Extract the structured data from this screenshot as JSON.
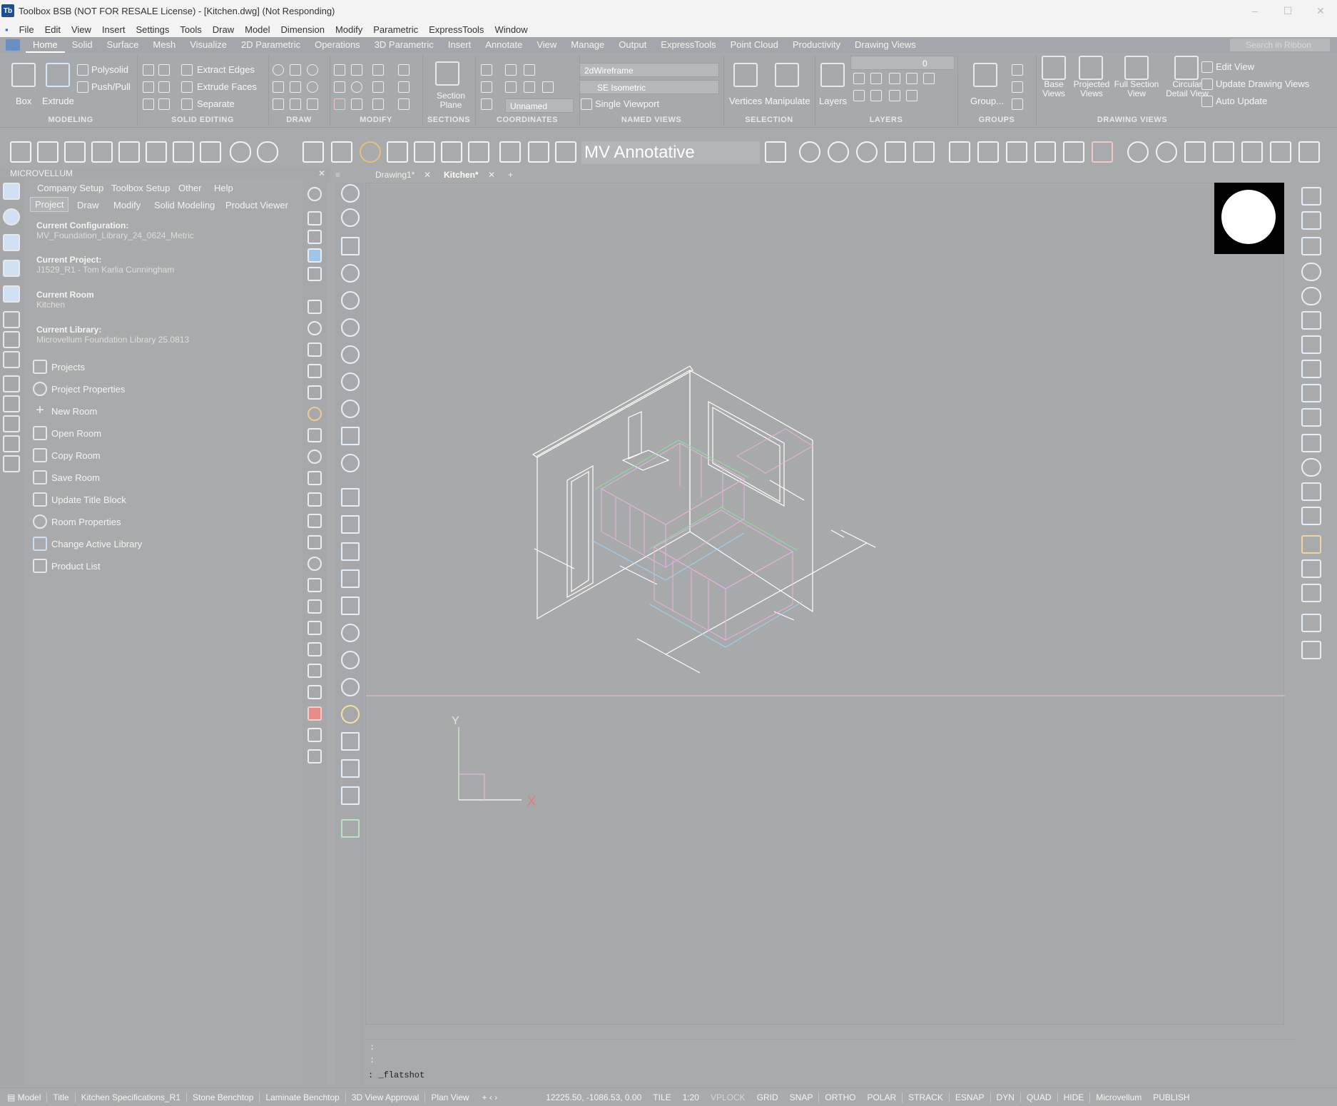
{
  "window": {
    "title": "Toolbox BSB (NOT FOR RESALE License) - [Kitchen.dwg] (Not Responding)",
    "logo": "Tb",
    "controls": [
      "–",
      "☐",
      "✕"
    ]
  },
  "menu": [
    "File",
    "Edit",
    "View",
    "Insert",
    "Settings",
    "Tools",
    "Draw",
    "Model",
    "Dimension",
    "Modify",
    "Parametric",
    "ExpressTools",
    "Window"
  ],
  "ribbon_tabs": [
    "Home",
    "Solid",
    "Surface",
    "Mesh",
    "Visualize",
    "2D Parametric",
    "Operations",
    "3D Parametric",
    "Insert",
    "Annotate",
    "View",
    "Manage",
    "Output",
    "ExpressTools",
    "Point Cloud",
    "Productivity",
    "Drawing Views"
  ],
  "ribbon_search": "Search in Ribbon",
  "ribbon": {
    "modeling": {
      "label": "MODELING",
      "box": "Box",
      "extrude": "Extrude",
      "polysolid": "Polysolid",
      "pushpull": "Push/Pull"
    },
    "solid_editing": {
      "label": "SOLID EDITING",
      "extract": "Extract Edges",
      "extrude_faces": "Extrude Faces",
      "separate": "Separate"
    },
    "draw": {
      "label": "DRAW"
    },
    "modify": {
      "label": "MODIFY"
    },
    "sections": {
      "label": "SECTIONS",
      "section_plane": "Section Plane"
    },
    "coordinates": {
      "label": "COORDINATES",
      "ucs": "Unnamed"
    },
    "named_views": {
      "label": "NAMED VIEWS",
      "visual_style": "2dWireframe",
      "view": "SE Isometric",
      "viewport": "Single Viewport"
    },
    "selection": {
      "label": "SELECTION",
      "vertices": "Vertices",
      "manipulate": "Manipulate"
    },
    "layers": {
      "label": "LAYERS",
      "layers": "Layers",
      "current": "0"
    },
    "groups": {
      "label": "GROUPS",
      "group": "Group..."
    },
    "drawing_views": {
      "label": "DRAWING VIEWS",
      "base": "Base Views",
      "projected": "Projected Views",
      "full_section": "Full Section View",
      "circular": "Circular Detail View",
      "edit": "Edit View",
      "update": "Update Drawing Views",
      "auto": "Auto Update"
    }
  },
  "annotative_style": "MV Annotative",
  "palette": {
    "title": "MICROVELLUM",
    "top_tabs": [
      "Company Setup",
      "Toolbox Setup",
      "Other",
      "Help"
    ],
    "tabs": [
      "Project",
      "Draw",
      "Modify",
      "Solid Modeling",
      "Product Viewer"
    ],
    "info": [
      {
        "label": "Current Configuration:",
        "value": "MV_Foundation_Library_24_0624_Metric"
      },
      {
        "label": "Current Project:",
        "value": "J1529_R1 - Tom  Karlia Cunningham"
      },
      {
        "label": "Current Room",
        "value": "Kitchen"
      },
      {
        "label": "Current Library:",
        "value": "Microvellum Foundation Library 25.0813"
      }
    ],
    "actions": [
      "Projects",
      "Project Properties",
      "New Room",
      "Open Room",
      "Copy Room",
      "Save Room",
      "Update Title Block",
      "Room Properties",
      "Change Active Library",
      "Product List"
    ]
  },
  "doc_tabs": [
    "Drawing1*",
    "Kitchen*"
  ],
  "ucs": {
    "x": "X",
    "y": "Y"
  },
  "command": {
    "history": [
      ":",
      ":"
    ],
    "current": ": _flatshot"
  },
  "status": {
    "model": "Model",
    "layouts": [
      "Title",
      "Kitchen Specifications_R1",
      "Stone Benchtop",
      "Laminate Benchtop",
      "3D View Approval",
      "Plan View"
    ],
    "coords": "12225.50, -1086.53, 0.00",
    "toggles": [
      "TILE",
      "1:20",
      "VPLOCK",
      "GRID",
      "SNAP",
      "ORTHO",
      "POLAR",
      "STRACK",
      "ESNAP",
      "DYN",
      "QUAD",
      "HIDE",
      "Microvellum",
      "PUBLISH"
    ]
  }
}
